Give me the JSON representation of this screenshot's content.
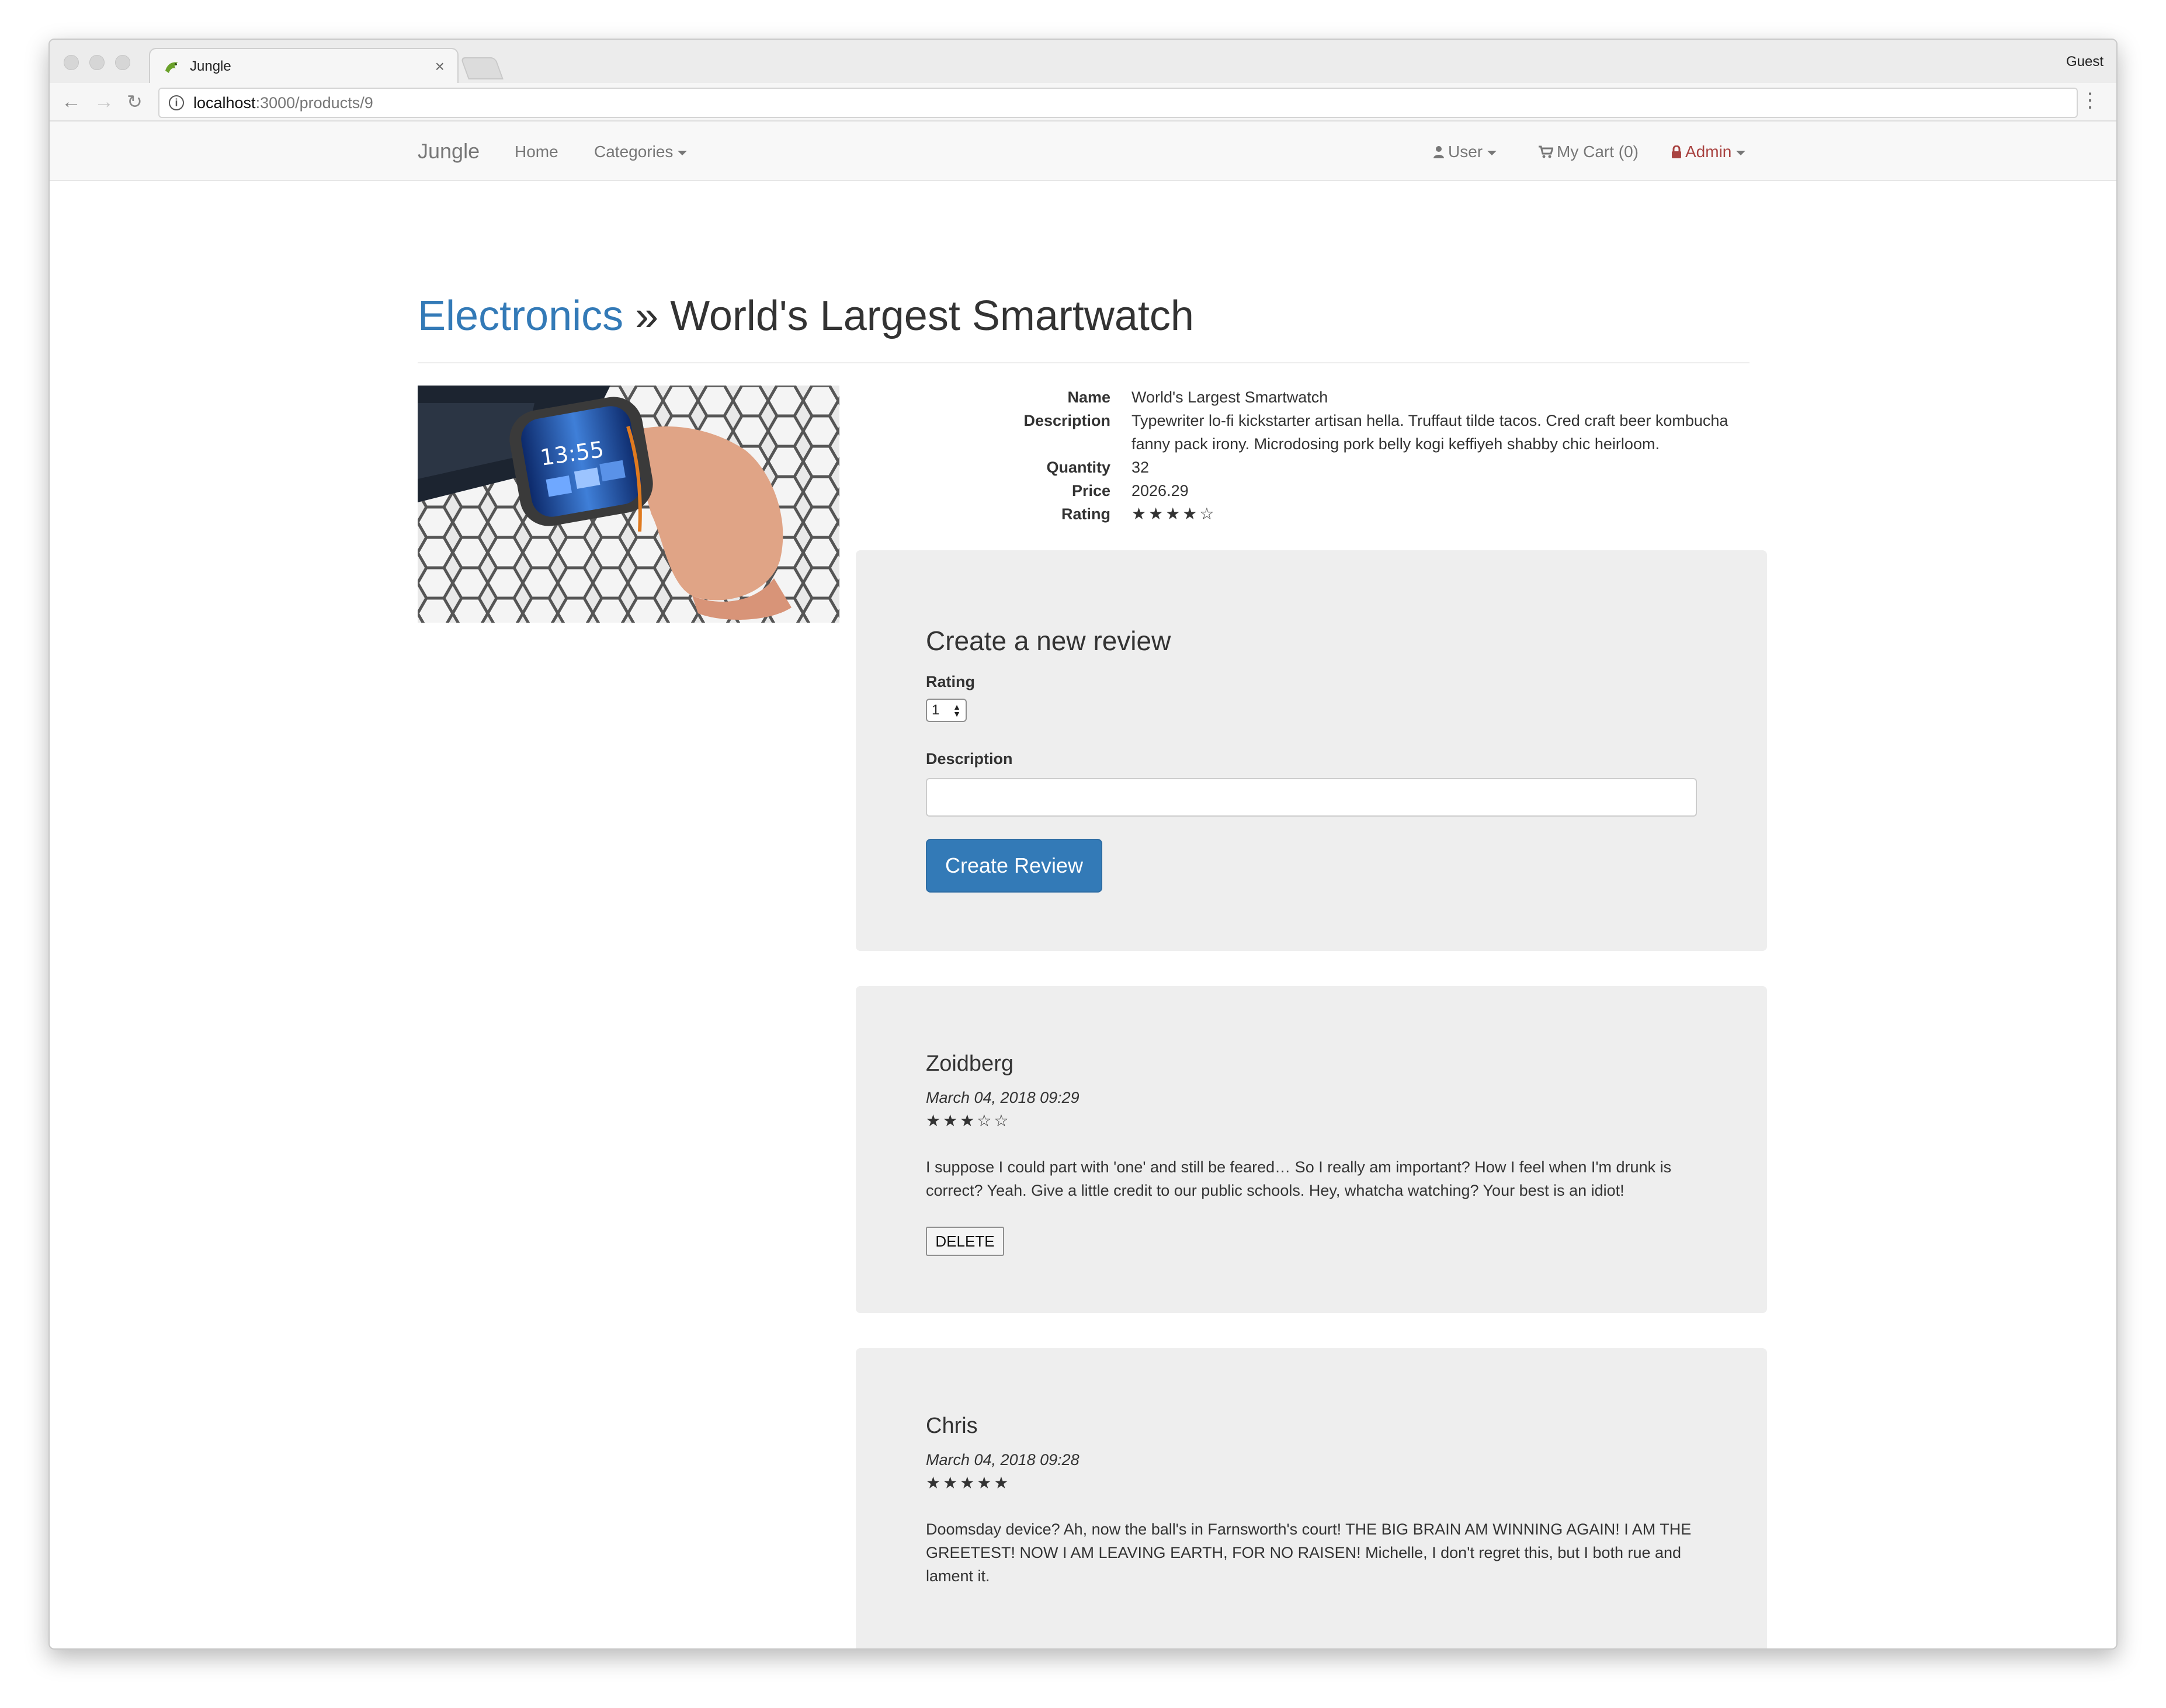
{
  "browser": {
    "tab_title": "Jungle",
    "profile": "Guest",
    "url_host": "localhost",
    "url_path": ":3000/products/9"
  },
  "navbar": {
    "brand": "Jungle",
    "home": "Home",
    "categories": "Categories",
    "user": "User",
    "cart": "My Cart (0)",
    "admin": "Admin"
  },
  "product": {
    "category": "Electronics",
    "separator": "»",
    "title": "World's Largest Smartwatch",
    "labels": {
      "name": "Name",
      "description": "Description",
      "quantity": "Quantity",
      "price": "Price",
      "rating": "Rating"
    },
    "name": "World's Largest Smartwatch",
    "description": "Typewriter lo-fi kickstarter artisan hella. Truffaut tilde tacos. Cred craft beer kombucha fanny pack irony. Microdosing pork belly kogi keffiyeh shabby chic heirloom.",
    "quantity": "32",
    "price": "2026.29",
    "rating_stars": "★★★★☆"
  },
  "review_form": {
    "heading": "Create a new review",
    "rating_label": "Rating",
    "rating_value": "1",
    "description_label": "Description",
    "description_value": "",
    "submit_label": "Create Review"
  },
  "reviews": [
    {
      "author": "Zoidberg",
      "date": "March 04, 2018 09:29",
      "stars": "★★★☆☆",
      "text": "I suppose I could part with 'one' and still be feared… So I really am important? How I feel when I'm drunk is correct? Yeah. Give a little credit to our public schools. Hey, whatcha watching? Your best is an idiot!",
      "delete_label": "DELETE"
    },
    {
      "author": "Chris",
      "date": "March 04, 2018 09:28",
      "stars": "★★★★★",
      "text": "Doomsday device? Ah, now the ball's in Farnsworth's court! THE BIG BRAIN AM WINNING AGAIN! I AM THE GREETEST! NOW I AM LEAVING EARTH, FOR NO RAISEN! Michelle, I don't regret this, but I both rue and lament it."
    }
  ]
}
